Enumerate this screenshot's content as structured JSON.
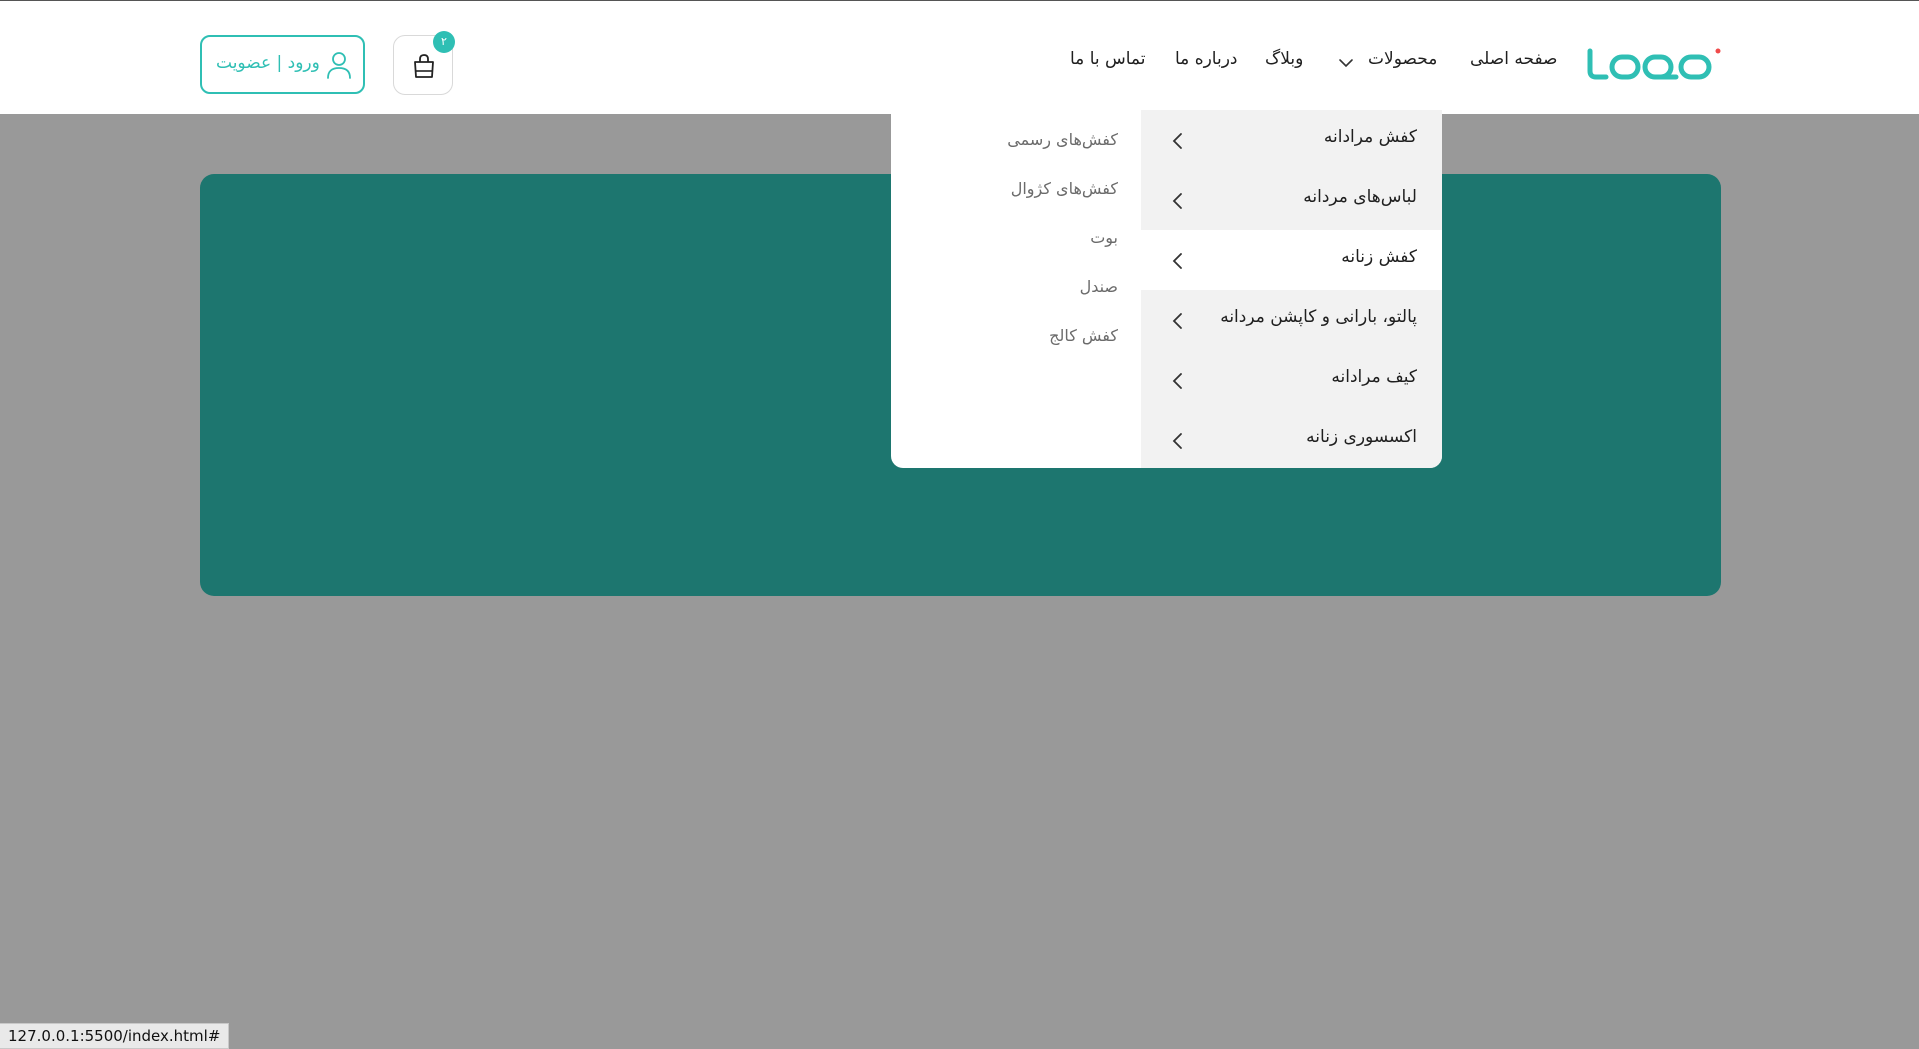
{
  "brand": {
    "logo_text": "LOQO",
    "accent_color": "#2fbfb4",
    "hero_color": "#1d766f"
  },
  "nav": {
    "items": [
      {
        "label": "صفحه اصلی"
      },
      {
        "label": "محصولات"
      },
      {
        "label": "وبلاگ"
      },
      {
        "label": "درباره ما"
      },
      {
        "label": "تماس با ما"
      }
    ]
  },
  "cart": {
    "badge": "۲",
    "icon": "shopping-bag-icon"
  },
  "login": {
    "label": "ورود | عضویت",
    "icon": "user-icon"
  },
  "mega_menu": {
    "categories": [
      {
        "label": "کفش مرادانه"
      },
      {
        "label": "لباس‌های مردانه"
      },
      {
        "label": "کفش زنانه",
        "active": true
      },
      {
        "label": "پالتو، بارانی و کاپشن مردانه"
      },
      {
        "label": "کیف مرادانه"
      },
      {
        "label": "اکسسوری زنانه"
      }
    ],
    "subcategories": [
      {
        "label": "کفش‌های رسمی"
      },
      {
        "label": "کفش‌های کژوال"
      },
      {
        "label": "بوت"
      },
      {
        "label": "صندل"
      },
      {
        "label": "کفش کالج"
      }
    ]
  },
  "status_bar": {
    "url": "127.0.0.1:5500/index.html#"
  }
}
